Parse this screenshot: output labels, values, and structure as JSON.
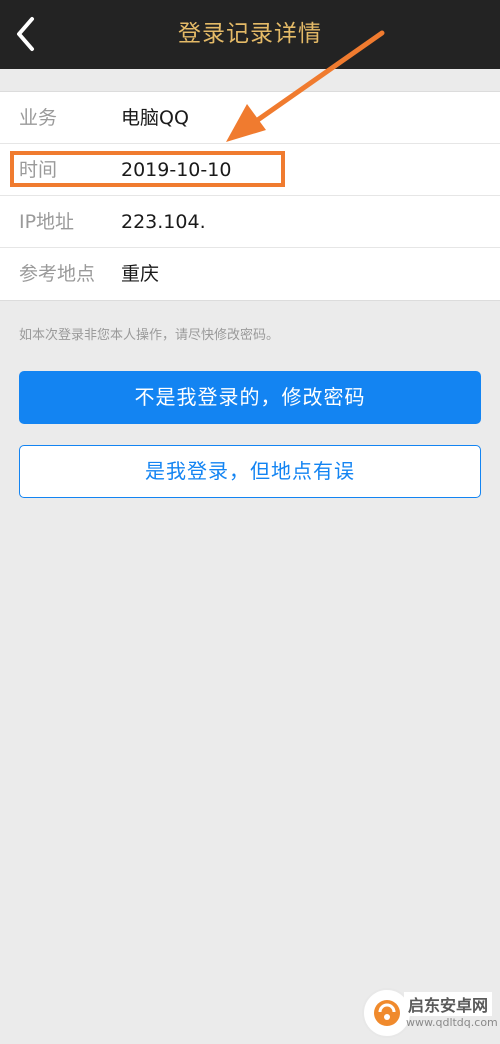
{
  "header": {
    "title": "登录记录详情"
  },
  "rows": [
    {
      "label": "业务",
      "value": "电脑QQ"
    },
    {
      "label": "时间",
      "value": "2019-10-10"
    },
    {
      "label": "IP地址",
      "value": "223.104."
    },
    {
      "label": "参考地点",
      "value": "重庆"
    }
  ],
  "notice": "如本次登录非您本人操作，请尽快修改密码。",
  "buttons": {
    "primary": "不是我登录的，修改密码",
    "secondary": "是我登录，但地点有误"
  },
  "watermark": {
    "text": "启东安卓网",
    "url": "www.qdltdq.com"
  },
  "colors": {
    "header_bg": "#232323",
    "title": "#e4ba67",
    "accent": "#1384f2",
    "annotation": "#f07b2f"
  }
}
